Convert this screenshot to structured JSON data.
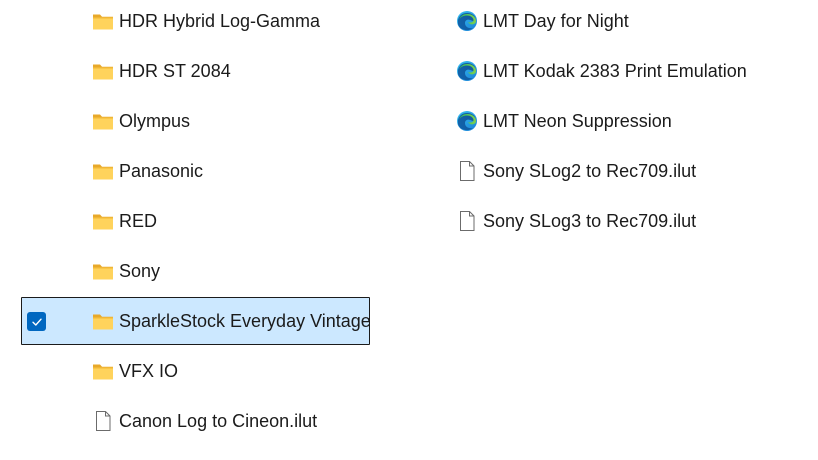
{
  "left_column": {
    "items": [
      {
        "label": "HDR Hybrid Log-Gamma",
        "type": "folder",
        "selected": false
      },
      {
        "label": "HDR ST 2084",
        "type": "folder",
        "selected": false
      },
      {
        "label": "Olympus",
        "type": "folder",
        "selected": false
      },
      {
        "label": "Panasonic",
        "type": "folder",
        "selected": false
      },
      {
        "label": "RED",
        "type": "folder",
        "selected": false
      },
      {
        "label": "Sony",
        "type": "folder",
        "selected": false
      },
      {
        "label": "SparkleStock Everyday Vintage",
        "type": "folder",
        "selected": true
      },
      {
        "label": "VFX IO",
        "type": "folder",
        "selected": false
      },
      {
        "label": "Canon Log to Cineon.ilut",
        "type": "file",
        "selected": false
      }
    ]
  },
  "right_column": {
    "items": [
      {
        "label": "LMT Day for Night",
        "type": "edge-file"
      },
      {
        "label": "LMT Kodak 2383 Print Emulation",
        "type": "edge-file"
      },
      {
        "label": "LMT Neon Suppression",
        "type": "edge-file"
      },
      {
        "label": "Sony SLog2 to Rec709.ilut",
        "type": "file"
      },
      {
        "label": "Sony SLog3 to Rec709.ilut",
        "type": "file"
      }
    ]
  },
  "colors": {
    "selection_background": "#cce8ff",
    "selection_border": "#1b1b1b",
    "checkbox": "#0067c0",
    "folder_body": "#ffd86b",
    "folder_tab": "#f0b93a"
  }
}
